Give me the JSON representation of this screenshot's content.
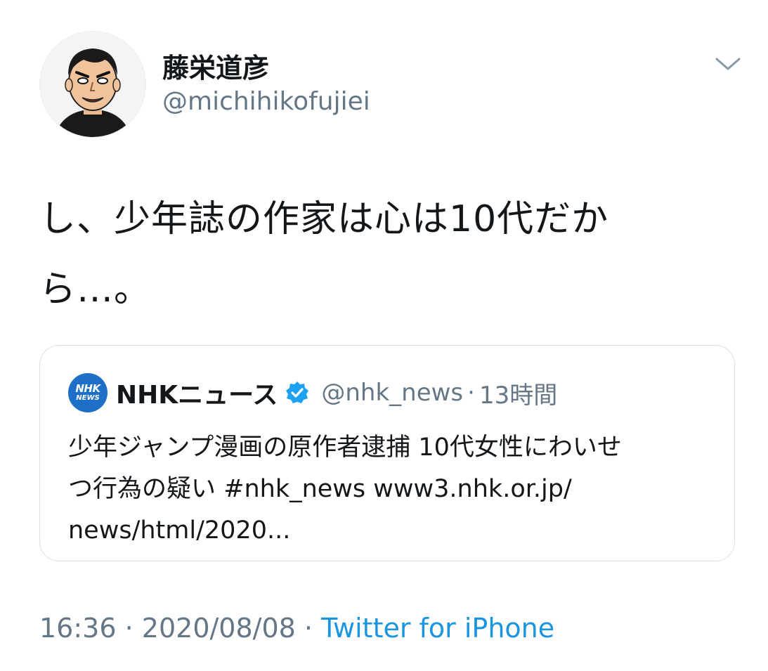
{
  "author": {
    "display_name": "藤栄道彦",
    "handle": "@michihikofujiei",
    "avatar_icon": "manga-portrait-avatar"
  },
  "tweet": {
    "text_lines": [
      "し、少年誌の作家は心は10代だか",
      "ら…。"
    ]
  },
  "quote": {
    "logo_text_top": "NHK",
    "logo_text_bottom": "NEWS",
    "name": "NHKニュース",
    "verified_icon": "verified-badge-icon",
    "handle": "@nhk_news",
    "separator": "·",
    "time": "13時間",
    "body_lines": [
      "少年ジャンプ漫画の原作者逮捕 10代女性にわいせ",
      "つ行為の疑い #nhk_news www3.nhk.or.jp/",
      "news/html/2020..."
    ]
  },
  "meta": {
    "time": "16:36",
    "separator": "·",
    "date": "2020/08/08",
    "source": "Twitter for iPhone"
  },
  "colors": {
    "text": "#14171a",
    "secondary": "#657786",
    "link": "#1b95e0",
    "verified": "#1da1f2",
    "nhk_blue": "#1d6fc8",
    "border": "#d9e0e6"
  }
}
